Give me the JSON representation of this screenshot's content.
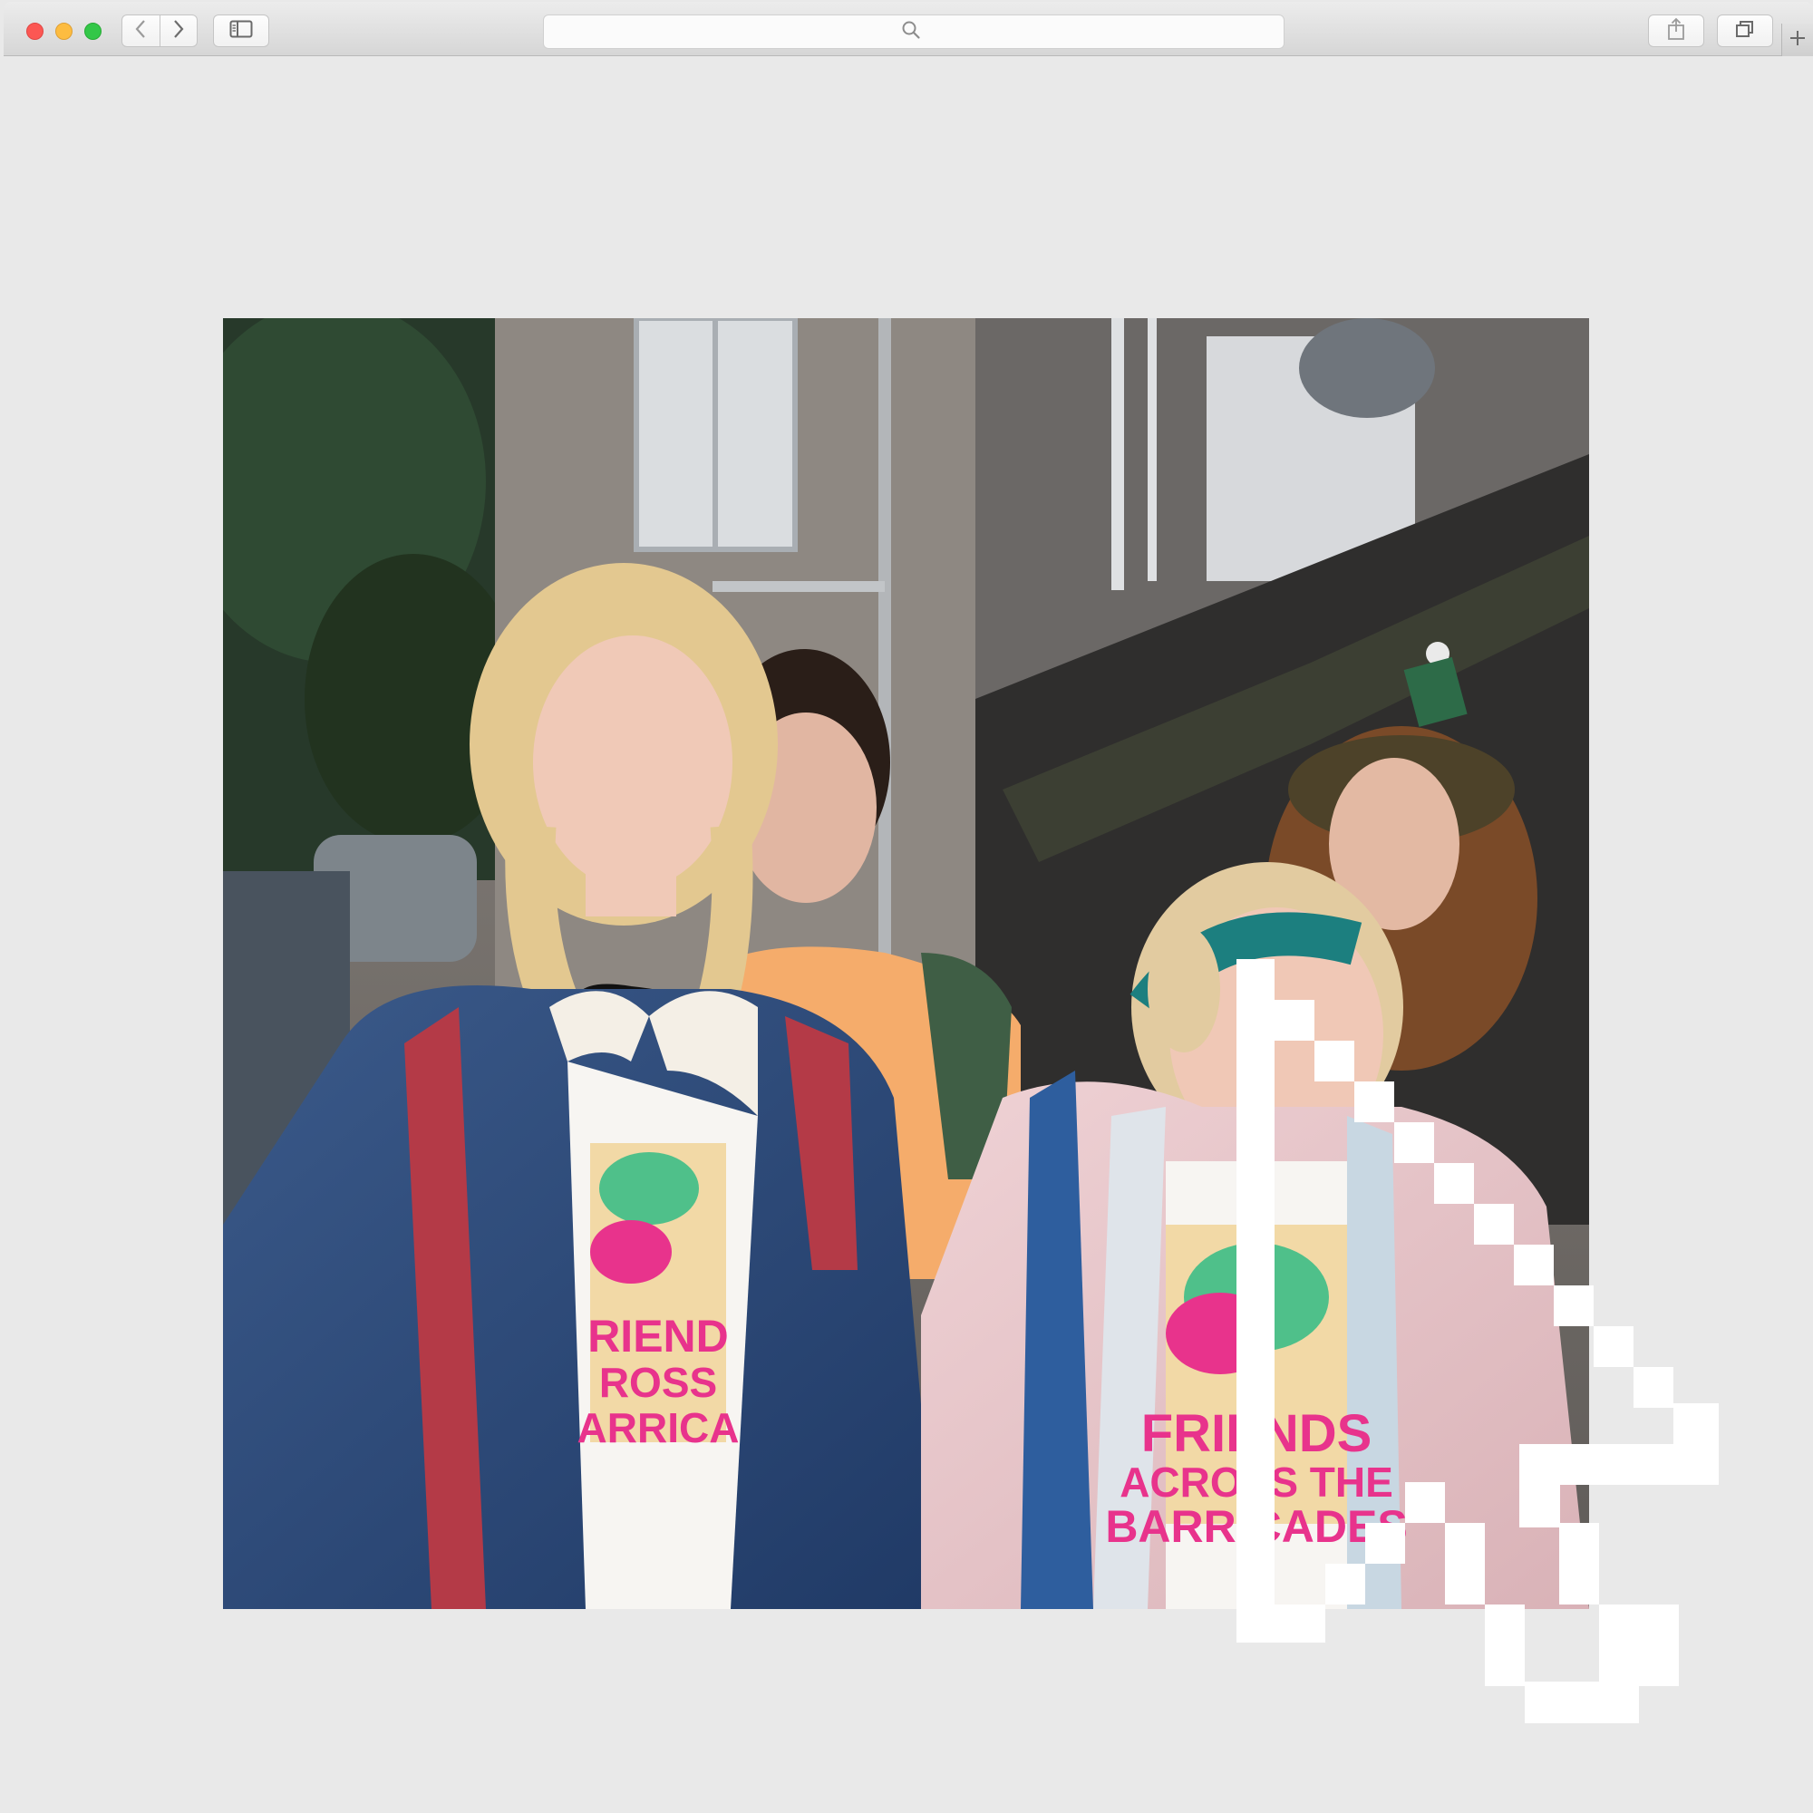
{
  "browser": {
    "traffic_lights": {
      "close_color": "#fc5753",
      "minimize_color": "#fdbc40",
      "maximize_color": "#33c748"
    },
    "back_icon": "chevron-left-icon",
    "forward_icon": "chevron-right-icon",
    "sidebar_icon": "sidebar-icon",
    "address_bar": {
      "icon": "search-icon",
      "value": ""
    },
    "share_icon": "share-icon",
    "tabs_icon": "tabs-overview-icon",
    "new_tab_icon": "plus-icon"
  },
  "page": {
    "image": {
      "shirt_print_left": [
        "RIEND",
        "ROSS",
        "ARRICA"
      ],
      "shirt_print_right": [
        "FRIENDS",
        "ACROSS THE",
        "BARRICADES"
      ],
      "colors": {
        "denim": "#2c4a78",
        "pink_jacket": "#e9c4c8",
        "headband": "#1c7f7f",
        "print_pink": "#e8338c",
        "print_green": "#4fc08a"
      }
    }
  },
  "cursor": {
    "icon": "pixel-arrow-cursor-icon",
    "color": "#ffffff"
  }
}
